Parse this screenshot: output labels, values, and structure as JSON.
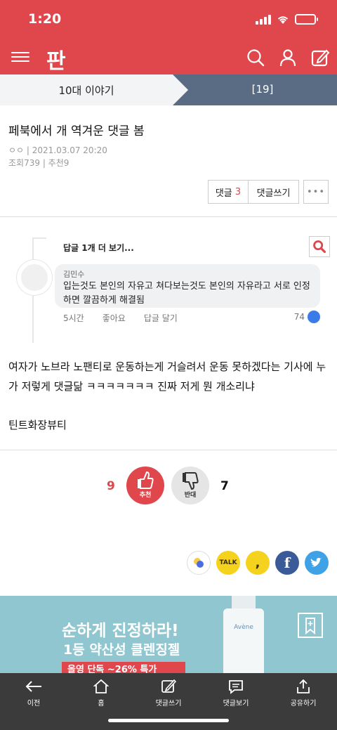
{
  "status": {
    "time": "1:20"
  },
  "header": {
    "logo": "판"
  },
  "tabs": [
    {
      "label": "10대 이야기"
    },
    {
      "label": "[19]"
    }
  ],
  "post": {
    "title": "페북에서 개 역겨운 댓글 봄",
    "author": "ㅇㅇ",
    "date": "| 2021.03.07 20:20",
    "views_label": "조회",
    "views": "739",
    "recommend_label": "| 추천",
    "recommend": "9"
  },
  "comment_buttons": {
    "comments_label": "댓글",
    "comments_count": "3",
    "write_label": "댓글쓰기",
    "more_label": "•••"
  },
  "embedded_comment": {
    "more_replies": "답글 1개 더 보기...",
    "author": "김민수",
    "text": "입는것도 본인의 자유고 쳐다보는것도 본인의 자유라고 서로 인정하면 깔끔하게 해결됨",
    "time": "5시간",
    "like": "좋아요",
    "reply": "답글 달기",
    "likes_count": "74"
  },
  "body": {
    "paragraph": "여자가 노브라 노팬티로 운동하는게 거슬려서 운동 못하겠다는 기사에 누가 저렇게 댓글닮 ㅋㅋㅋㅋㅋㅋㅋ 진짜 저게 뭔 개소리냐",
    "signature": "틴트화장뷰티"
  },
  "votes": {
    "up_count": "9",
    "up_label": "추천",
    "down_label": "반대",
    "down_count": "7"
  },
  "share": {
    "kakaotalk": "TALK",
    "kakaostory": ","
  },
  "ad": {
    "title": "순하게 진정하라!",
    "subtitle": "1등 약산성 클렌징젤",
    "bar_text": "올영 단독 ~26% 특가",
    "bottle_brand": "Avène"
  },
  "bottom_nav": [
    {
      "label": "이전",
      "icon": "arrow-left-icon"
    },
    {
      "label": "홈",
      "icon": "home-icon"
    },
    {
      "label": "댓글쓰기",
      "icon": "pencil-icon"
    },
    {
      "label": "댓글보기",
      "icon": "comment-icon"
    },
    {
      "label": "공유하기",
      "icon": "share-icon"
    }
  ],
  "colors": {
    "brand": "#e0474c",
    "tab_inactive": "#5a6c84",
    "bottom_bar": "#3b3b3b"
  }
}
